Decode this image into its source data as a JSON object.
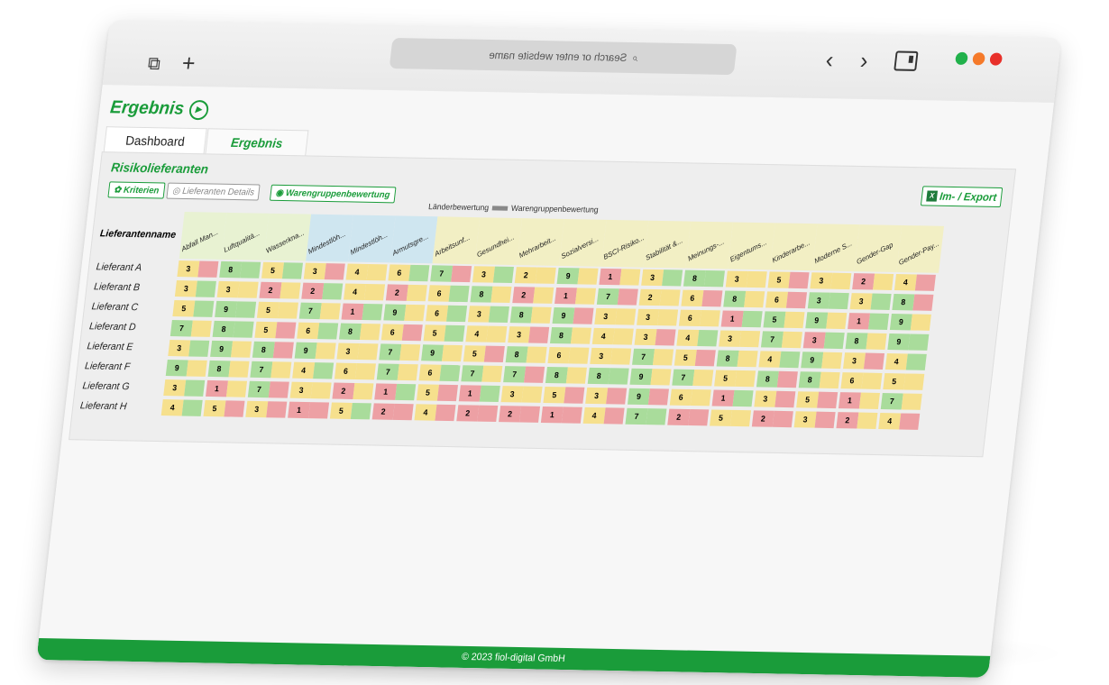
{
  "browser": {
    "url_placeholder": "Search or enter website name",
    "url_display": "emɐn ətiꞩdəw rətnə ro hɔɿɒəꞨ"
  },
  "page": {
    "title": "Ergebnis",
    "tabs": [
      {
        "label": "Dashboard"
      },
      {
        "label": "Ergebnis"
      }
    ],
    "section_title": "Risikolieferanten",
    "buttons": {
      "kriterien": "Kriterien",
      "details": "Lieferanten Details",
      "warengruppe": "Warengruppenbewertung",
      "export": "Im- / Export"
    },
    "legend": {
      "left": "Länderbewertung",
      "right": "Warengruppenbewertung"
    },
    "name_header": "Lieferantenname",
    "footer": "© 2023 fiol-digital GmbH"
  },
  "columns": [
    "Abfall Man...",
    "Luftqualitä...",
    "Wasserkna...",
    "Mindestlöh...",
    "Mindestlöh...",
    "Armutsgre...",
    "Arbeitsunf...",
    "Gesundhei...",
    "Mehrarbeit...",
    "Sozialversi...",
    "BSCI-Risiko...",
    "Stabilität &...",
    "Meinungs-...",
    "Eigentums...",
    "Kinderarbe...",
    "Moderne S...",
    "Gender-Gap",
    "Gender-Pay..."
  ],
  "column_groups": [
    0,
    0,
    0,
    1,
    1,
    1,
    2,
    2,
    2,
    2,
    2,
    2,
    2,
    2,
    2,
    2,
    2,
    2
  ],
  "colors": {
    "green": "#a9dc9b",
    "yellow": "#f6e08d",
    "red": "#eda0a4",
    "brand": "#1a9c3a"
  },
  "rows": [
    {
      "name": "Lieferant A",
      "values": [
        3,
        8,
        5,
        3,
        4,
        6,
        7,
        3,
        2,
        9,
        1,
        3,
        8,
        3,
        5,
        3,
        2,
        4
      ],
      "colors": [
        [
          "y",
          "r"
        ],
        [
          "g",
          "g"
        ],
        [
          "y",
          "g"
        ],
        [
          "y",
          "r"
        ],
        [
          "y",
          "y"
        ],
        [
          "y",
          "g"
        ],
        [
          "g",
          "r"
        ],
        [
          "y",
          "g"
        ],
        [
          "y",
          "y"
        ],
        [
          "g",
          "y"
        ],
        [
          "r",
          "y"
        ],
        [
          "y",
          "g"
        ],
        [
          "g",
          "g"
        ],
        [
          "y",
          "y"
        ],
        [
          "y",
          "r"
        ],
        [
          "y",
          "y"
        ],
        [
          "r",
          "y"
        ],
        [
          "y",
          "r"
        ]
      ]
    },
    {
      "name": "Lieferant B",
      "values": [
        3,
        3,
        2,
        2,
        4,
        2,
        6,
        8,
        2,
        1,
        7,
        2,
        6,
        8,
        6,
        3,
        3,
        8
      ],
      "colors": [
        [
          "y",
          "g"
        ],
        [
          "y",
          "y"
        ],
        [
          "r",
          "y"
        ],
        [
          "r",
          "g"
        ],
        [
          "y",
          "y"
        ],
        [
          "r",
          "y"
        ],
        [
          "y",
          "g"
        ],
        [
          "g",
          "y"
        ],
        [
          "r",
          "y"
        ],
        [
          "r",
          "y"
        ],
        [
          "g",
          "r"
        ],
        [
          "y",
          "y"
        ],
        [
          "y",
          "r"
        ],
        [
          "g",
          "y"
        ],
        [
          "y",
          "r"
        ],
        [
          "g",
          "g"
        ],
        [
          "y",
          "g"
        ],
        [
          "g",
          "r"
        ]
      ]
    },
    {
      "name": "Lieferant C",
      "values": [
        5,
        9,
        5,
        7,
        1,
        9,
        6,
        3,
        8,
        9,
        3,
        3,
        6,
        1,
        5,
        9,
        1,
        9
      ],
      "colors": [
        [
          "y",
          "g"
        ],
        [
          "g",
          "g"
        ],
        [
          "y",
          "y"
        ],
        [
          "g",
          "y"
        ],
        [
          "r",
          "g"
        ],
        [
          "g",
          "y"
        ],
        [
          "y",
          "g"
        ],
        [
          "y",
          "g"
        ],
        [
          "g",
          "y"
        ],
        [
          "g",
          "r"
        ],
        [
          "y",
          "y"
        ],
        [
          "y",
          "y"
        ],
        [
          "y",
          "y"
        ],
        [
          "r",
          "g"
        ],
        [
          "g",
          "y"
        ],
        [
          "g",
          "y"
        ],
        [
          "r",
          "g"
        ],
        [
          "g",
          "y"
        ]
      ]
    },
    {
      "name": "Lieferant D",
      "values": [
        7,
        8,
        5,
        6,
        8,
        6,
        5,
        4,
        3,
        8,
        4,
        3,
        4,
        3,
        7,
        3,
        8,
        9
      ],
      "colors": [
        [
          "g",
          "y"
        ],
        [
          "g",
          "g"
        ],
        [
          "y",
          "r"
        ],
        [
          "y",
          "g"
        ],
        [
          "g",
          "y"
        ],
        [
          "y",
          "r"
        ],
        [
          "y",
          "g"
        ],
        [
          "y",
          "y"
        ],
        [
          "y",
          "r"
        ],
        [
          "g",
          "y"
        ],
        [
          "y",
          "y"
        ],
        [
          "y",
          "r"
        ],
        [
          "y",
          "g"
        ],
        [
          "y",
          "y"
        ],
        [
          "g",
          "y"
        ],
        [
          "r",
          "g"
        ],
        [
          "g",
          "y"
        ],
        [
          "g",
          "g"
        ]
      ]
    },
    {
      "name": "Lieferant E",
      "values": [
        3,
        9,
        8,
        9,
        3,
        7,
        9,
        5,
        8,
        6,
        3,
        7,
        5,
        8,
        4,
        9,
        3,
        4
      ],
      "colors": [
        [
          "y",
          "g"
        ],
        [
          "g",
          "y"
        ],
        [
          "g",
          "r"
        ],
        [
          "g",
          "y"
        ],
        [
          "y",
          "y"
        ],
        [
          "g",
          "y"
        ],
        [
          "g",
          "y"
        ],
        [
          "y",
          "r"
        ],
        [
          "g",
          "y"
        ],
        [
          "y",
          "y"
        ],
        [
          "y",
          "y"
        ],
        [
          "g",
          "y"
        ],
        [
          "y",
          "r"
        ],
        [
          "g",
          "y"
        ],
        [
          "y",
          "g"
        ],
        [
          "g",
          "y"
        ],
        [
          "y",
          "r"
        ],
        [
          "y",
          "g"
        ]
      ]
    },
    {
      "name": "Lieferant F",
      "values": [
        9,
        8,
        7,
        4,
        6,
        7,
        6,
        7,
        7,
        8,
        8,
        9,
        7,
        5,
        8,
        8,
        6,
        5
      ],
      "colors": [
        [
          "g",
          "y"
        ],
        [
          "g",
          "y"
        ],
        [
          "g",
          "y"
        ],
        [
          "y",
          "g"
        ],
        [
          "y",
          "y"
        ],
        [
          "g",
          "y"
        ],
        [
          "y",
          "g"
        ],
        [
          "g",
          "y"
        ],
        [
          "g",
          "r"
        ],
        [
          "g",
          "y"
        ],
        [
          "g",
          "g"
        ],
        [
          "g",
          "y"
        ],
        [
          "g",
          "y"
        ],
        [
          "y",
          "y"
        ],
        [
          "g",
          "r"
        ],
        [
          "g",
          "y"
        ],
        [
          "y",
          "y"
        ],
        [
          "y",
          "y"
        ]
      ]
    },
    {
      "name": "Lieferant G",
      "values": [
        3,
        1,
        7,
        3,
        2,
        1,
        5,
        1,
        3,
        5,
        3,
        9,
        6,
        1,
        3,
        5,
        1,
        7
      ],
      "colors": [
        [
          "y",
          "g"
        ],
        [
          "r",
          "y"
        ],
        [
          "g",
          "r"
        ],
        [
          "y",
          "y"
        ],
        [
          "r",
          "y"
        ],
        [
          "r",
          "g"
        ],
        [
          "y",
          "r"
        ],
        [
          "r",
          "g"
        ],
        [
          "y",
          "y"
        ],
        [
          "y",
          "r"
        ],
        [
          "y",
          "r"
        ],
        [
          "g",
          "r"
        ],
        [
          "y",
          "y"
        ],
        [
          "r",
          "g"
        ],
        [
          "y",
          "r"
        ],
        [
          "y",
          "r"
        ],
        [
          "r",
          "y"
        ],
        [
          "g",
          "y"
        ]
      ]
    },
    {
      "name": "Lieferant H",
      "values": [
        4,
        5,
        3,
        1,
        5,
        2,
        4,
        2,
        2,
        1,
        4,
        7,
        2,
        5,
        2,
        3,
        2,
        4
      ],
      "colors": [
        [
          "y",
          "g"
        ],
        [
          "y",
          "r"
        ],
        [
          "y",
          "r"
        ],
        [
          "r",
          "r"
        ],
        [
          "y",
          "g"
        ],
        [
          "r",
          "r"
        ],
        [
          "y",
          "r"
        ],
        [
          "r",
          "r"
        ],
        [
          "r",
          "r"
        ],
        [
          "r",
          "r"
        ],
        [
          "y",
          "r"
        ],
        [
          "g",
          "g"
        ],
        [
          "r",
          "r"
        ],
        [
          "y",
          "y"
        ],
        [
          "r",
          "r"
        ],
        [
          "y",
          "r"
        ],
        [
          "r",
          "y"
        ],
        [
          "y",
          "r"
        ]
      ]
    }
  ]
}
